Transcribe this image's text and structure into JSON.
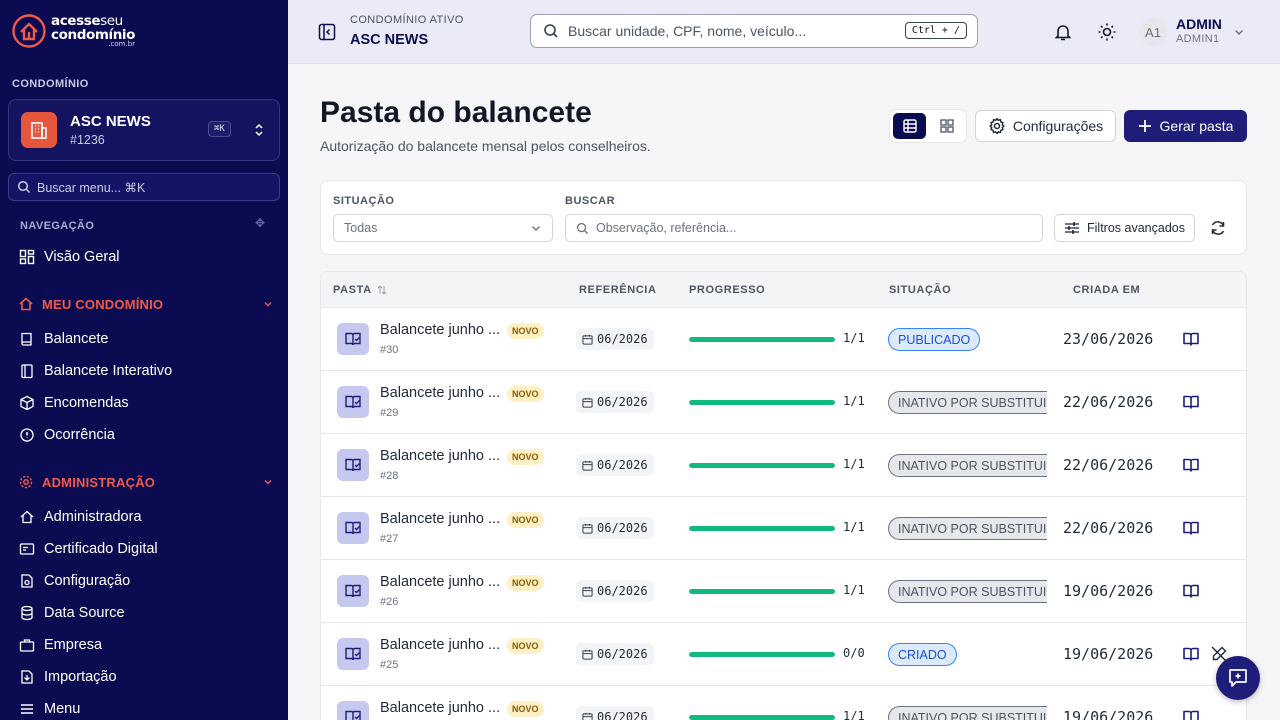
{
  "sidebar": {
    "logo": {
      "line1_bold": "acesse",
      "line1_light": "seu",
      "line2": "condomínio",
      "line3": ".com.br"
    },
    "section_label": "CONDOMÍNIO",
    "condo": {
      "name": "ASC NEWS",
      "code": "#1236",
      "shortcut": "⌘K"
    },
    "search_placeholder": "Buscar menu... ⌘K",
    "nav_label": "NAVEGAÇÃO",
    "overview": "Visão Geral",
    "group1": {
      "label": "MEU CONDOMÍNIO",
      "items": [
        "Balancete",
        "Balancete Interativo",
        "Encomendas",
        "Ocorrência"
      ]
    },
    "group2": {
      "label": "ADMINISTRAÇÃO",
      "items": [
        "Administradora",
        "Certificado Digital",
        "Configuração",
        "Data Source",
        "Empresa",
        "Importação",
        "Menu"
      ]
    }
  },
  "header": {
    "active_label": "CONDOMÍNIO ATIVO",
    "active_name": "ASC NEWS",
    "search_placeholder": "Buscar unidade, CPF, nome, veículo...",
    "search_shortcut": "Ctrl + /",
    "avatar": "A1",
    "user_name": "ADMIN",
    "user_role": "ADMIN1"
  },
  "page": {
    "title": "Pasta do balancete",
    "subtitle": "Autorização do balancete mensal pelos conselheiros.",
    "config_label": "Configurações",
    "primary_label": "Gerar pasta"
  },
  "filters": {
    "status_label": "SITUAÇÃO",
    "status_value": "Todas",
    "search_label": "BUSCAR",
    "search_placeholder": "Observação, referência...",
    "advanced_label": "Filtros avançados"
  },
  "table": {
    "headers": {
      "folder": "PASTA",
      "reference": "REFERÊNCIA",
      "progress": "PROGRESSO",
      "status": "SITUAÇÃO",
      "created": "CRIADA EM"
    },
    "rows": [
      {
        "title": "Balancete junho ...",
        "badge": "NOVO",
        "num": "#30",
        "ref": "06/2026",
        "progress": 1.0,
        "progress_text": "1/1",
        "status": "PUBLICADO",
        "status_type": "pub",
        "date": "23/06/2026",
        "edit": false
      },
      {
        "title": "Balancete junho ...",
        "badge": "NOVO",
        "num": "#29",
        "ref": "06/2026",
        "progress": 1.0,
        "progress_text": "1/1",
        "status": "INATIVO POR SUBSTITUIÇÃO",
        "status_type": "inact",
        "date": "22/06/2026",
        "edit": false
      },
      {
        "title": "Balancete junho ...",
        "badge": "NOVO",
        "num": "#28",
        "ref": "06/2026",
        "progress": 1.0,
        "progress_text": "1/1",
        "status": "INATIVO POR SUBSTITUIÇÃO",
        "status_type": "inact",
        "date": "22/06/2026",
        "edit": false
      },
      {
        "title": "Balancete junho ...",
        "badge": "NOVO",
        "num": "#27",
        "ref": "06/2026",
        "progress": 1.0,
        "progress_text": "1/1",
        "status": "INATIVO POR SUBSTITUIÇÃO",
        "status_type": "inact",
        "date": "22/06/2026",
        "edit": false
      },
      {
        "title": "Balancete junho ...",
        "badge": "NOVO",
        "num": "#26",
        "ref": "06/2026",
        "progress": 1.0,
        "progress_text": "1/1",
        "status": "INATIVO POR SUBSTITUIÇÃO",
        "status_type": "inact",
        "date": "19/06/2026",
        "edit": false
      },
      {
        "title": "Balancete junho ...",
        "badge": "NOVO",
        "num": "#25",
        "ref": "06/2026",
        "progress": 1.0,
        "progress_text": "0/0",
        "status": "CRIADO",
        "status_type": "pub",
        "date": "19/06/2026",
        "edit": true
      },
      {
        "title": "Balancete junho ...",
        "badge": "NOVO",
        "num": "",
        "ref": "06/2026",
        "progress": 1.0,
        "progress_text": "1/1",
        "status": "INATIVO POR SUBSTITUIÇÃO",
        "status_type": "inact",
        "date": "19/06/2026",
        "edit": false
      }
    ]
  },
  "colors": {
    "sidebar_bg": "#0b0b52",
    "accent_red": "#ef5a4a",
    "primary": "#1e1e7a",
    "progress": "#10b981"
  }
}
